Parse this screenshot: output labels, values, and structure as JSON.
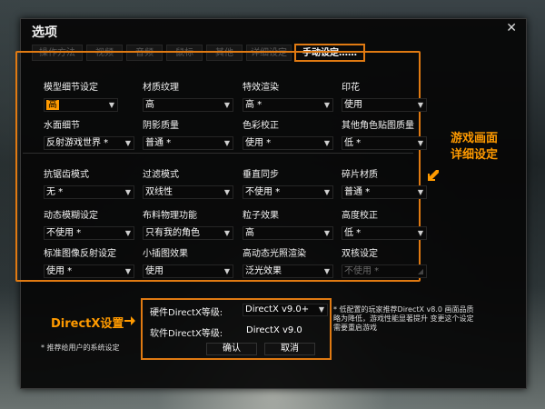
{
  "window": {
    "title": "选项",
    "close_glyph": "✕"
  },
  "tabs": [
    {
      "label": "操作方法",
      "active": false
    },
    {
      "label": "视频",
      "active": false
    },
    {
      "label": "音频",
      "active": false
    },
    {
      "label": "鼠标",
      "active": false
    },
    {
      "label": "其他",
      "active": false
    },
    {
      "label": "详细设定",
      "active": false
    },
    {
      "label": "手动设定……",
      "active": true
    }
  ],
  "settings": {
    "model_detail": {
      "label": "模型细节设定",
      "value": "高"
    },
    "texture": {
      "label": "材质纹理",
      "value": "高"
    },
    "effects": {
      "label": "特效渲染",
      "value": "高 *"
    },
    "decal": {
      "label": "印花",
      "value": "使用"
    },
    "water_detail": {
      "label": "水面细节",
      "value": "反射游戏世界 *"
    },
    "shadow_quality": {
      "label": "阴影质量",
      "value": "普通 *"
    },
    "color_correction": {
      "label": "色彩校正",
      "value": "使用 *"
    },
    "other_char_texture": {
      "label": "其他角色贴图质量",
      "value": "低 *"
    },
    "antialiasing": {
      "label": "抗锯齿模式",
      "value": "无 *"
    },
    "filter_mode": {
      "label": "过滤模式",
      "value": "双线性"
    },
    "vsync": {
      "label": "垂直同步",
      "value": "不使用 *"
    },
    "fragment_material": {
      "label": "碎片材质",
      "value": "普通 *"
    },
    "motion_blur": {
      "label": "动态模糊设定",
      "value": "不使用 *"
    },
    "cloth_physics": {
      "label": "布料物理功能",
      "value": "只有我的角色"
    },
    "particles": {
      "label": "粒子效果",
      "value": "高"
    },
    "height_correction": {
      "label": "高度校正",
      "value": "低 *"
    },
    "std_reflection": {
      "label": "标准图像反射设定",
      "value": "使用 *"
    },
    "minimap_effect": {
      "label": "小插图效果",
      "value": "使用"
    },
    "hdr": {
      "label": "高动态光照渲染",
      "value": "泛光效果"
    },
    "dual_core": {
      "label": "双核设定",
      "value": "不使用 *"
    }
  },
  "annotations": {
    "side_line1": "游戏画面",
    "side_line2": "详细设定",
    "directx": "DirectX设置"
  },
  "directx": {
    "hw_label": "硬件DirectX等级:",
    "hw_value": "DirectX v9.0+",
    "sw_label": "软件DirectX等级:",
    "sw_value": "DirectX v9.0"
  },
  "buttons": {
    "confirm": "确认",
    "cancel": "取消"
  },
  "notes": {
    "low_config": "* 低配置的玩家推荐DirectX v8.0 画面品质略为降低，游戏性能显著提升 变更这个设定需要重启游戏",
    "recommended": "* 推荐给用户的系统设定"
  },
  "colors": {
    "accent": "#e07a12",
    "highlight": "#ff9a00",
    "dialog_bg": "#060606"
  }
}
